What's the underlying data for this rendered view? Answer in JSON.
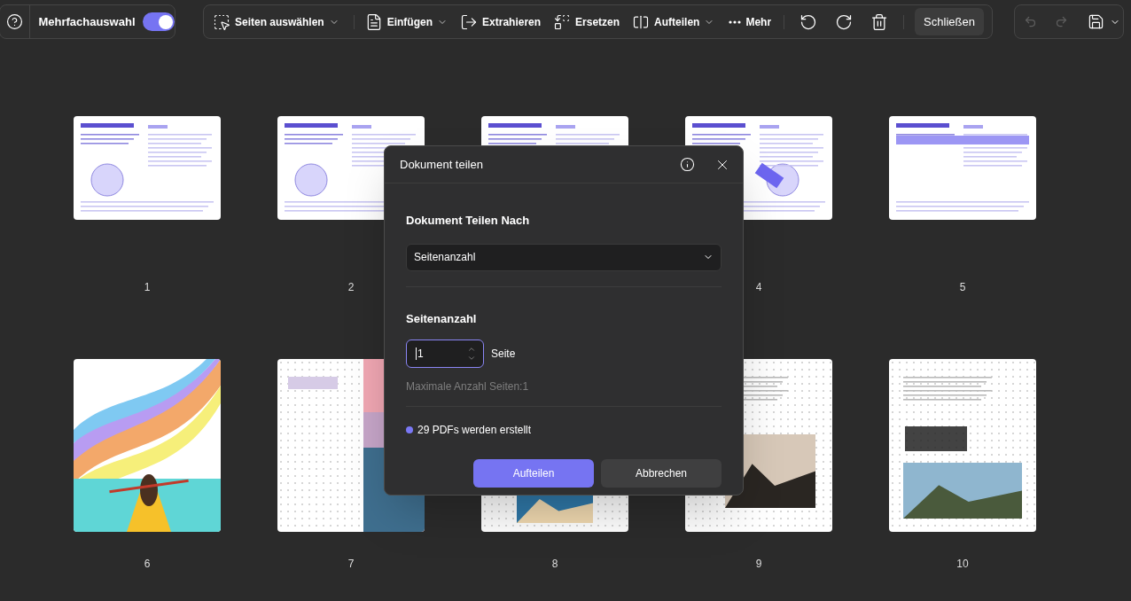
{
  "multiselect": {
    "label": "Mehrfachauswahl",
    "on": true
  },
  "tools": [
    {
      "label": "Seiten auswählen",
      "has_menu": true
    },
    {
      "label": "Einfügen",
      "has_menu": true
    },
    {
      "label": "Extrahieren",
      "has_menu": false
    },
    {
      "label": "Ersetzen",
      "has_menu": false
    },
    {
      "label": "Aufteilen",
      "has_menu": true
    },
    {
      "label": "Mehr",
      "has_menu": false
    }
  ],
  "close_button": "Schließen",
  "history": {
    "undo_disabled": true,
    "redo_disabled": true
  },
  "page_rows": [
    [
      {
        "label": "1"
      },
      {
        "label": "2"
      },
      {},
      {
        "label": "4"
      },
      {
        "label": "5"
      }
    ],
    [
      {
        "label": "6"
      },
      {
        "label": "7"
      },
      {
        "label": "8"
      },
      {
        "label": "9"
      },
      {
        "label": "10"
      }
    ]
  ],
  "dialog": {
    "title": "Dokument teilen",
    "split_by_heading": "Dokument Teilen Nach",
    "split_by_value": "Seitenanzahl",
    "count_heading": "Seitenanzahl",
    "count_value": "1",
    "count_unit": "Seite",
    "hint": "Maximale Anzahl Seiten:1",
    "status": {
      "text": "29 PDFs werden erstellt",
      "color": "#7a78f5"
    },
    "buttons": [
      {
        "label": "Aufteilen",
        "kind": "primary"
      },
      {
        "label": "Abbrechen",
        "kind": "secondary"
      }
    ]
  }
}
